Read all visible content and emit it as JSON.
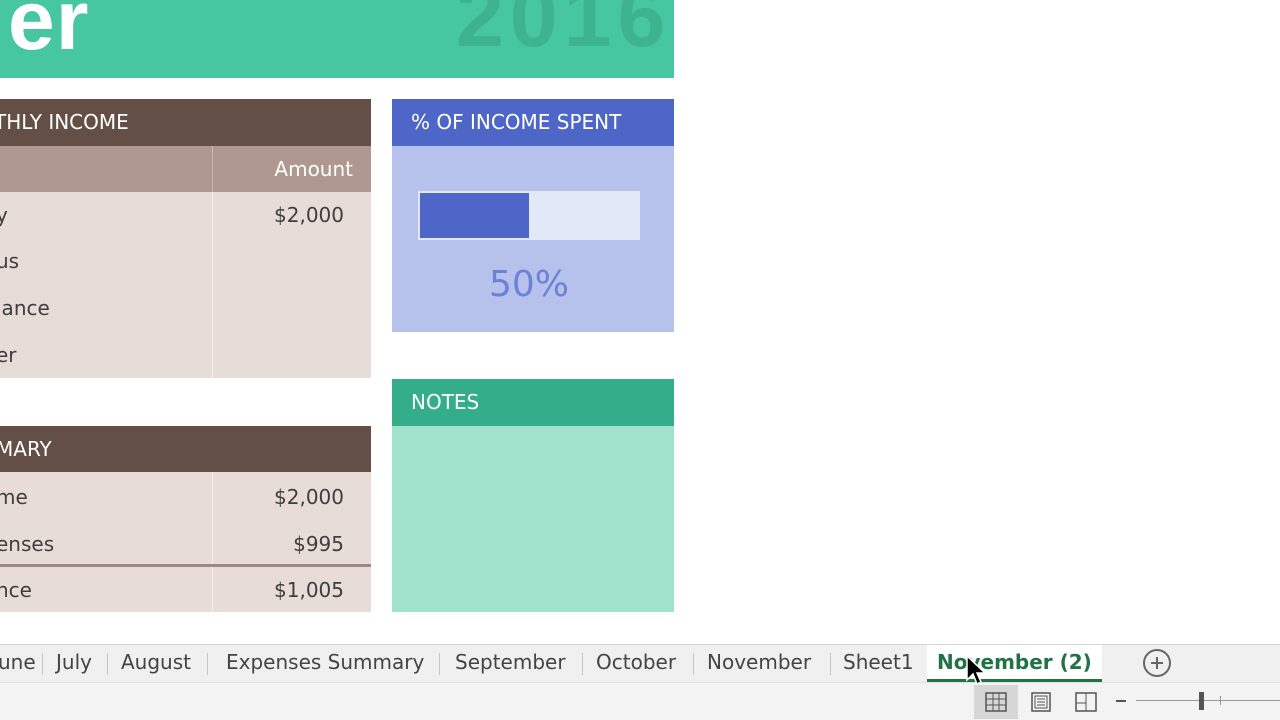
{
  "banner": {
    "title_fragment": "er",
    "year": "2016"
  },
  "income": {
    "header": "THLY INCOME",
    "col_left": "",
    "col_right": "Amount",
    "rows": [
      {
        "label": "y",
        "amount": "$2,000"
      },
      {
        "label": "us",
        "amount": ""
      },
      {
        "label": "lance",
        "amount": ""
      },
      {
        "label": "er",
        "amount": ""
      }
    ]
  },
  "summary": {
    "header": "MARY",
    "rows": [
      {
        "label": "me",
        "amount": "$2,000"
      },
      {
        "label": "enses",
        "amount": "$995"
      },
      {
        "label": "nce",
        "amount": "$1,005"
      }
    ]
  },
  "percent_spent": {
    "header": "% OF INCOME SPENT",
    "value_text": "50%",
    "fill_fraction": 0.5
  },
  "notes": {
    "header": "NOTES"
  },
  "sheet_tabs": [
    {
      "label": "une",
      "active": false
    },
    {
      "label": "July",
      "active": false
    },
    {
      "label": "August",
      "active": false
    },
    {
      "label": "Expenses Summary",
      "active": false
    },
    {
      "label": "September",
      "active": false
    },
    {
      "label": "October",
      "active": false
    },
    {
      "label": "November",
      "active": false
    },
    {
      "label": "Sheet1",
      "active": false
    },
    {
      "label": "November (2)",
      "active": true
    }
  ],
  "colors": {
    "banner": "#47c7a1",
    "income_header": "#634f45",
    "percent_header": "#4f66c9",
    "notes_header": "#34ae8a",
    "active_tab": "#217346"
  },
  "icons": {
    "add_sheet": "plus-circle-icon",
    "normal_view": "grid-icon",
    "page_layout_view": "page-icon",
    "page_break_view": "page-break-icon"
  }
}
